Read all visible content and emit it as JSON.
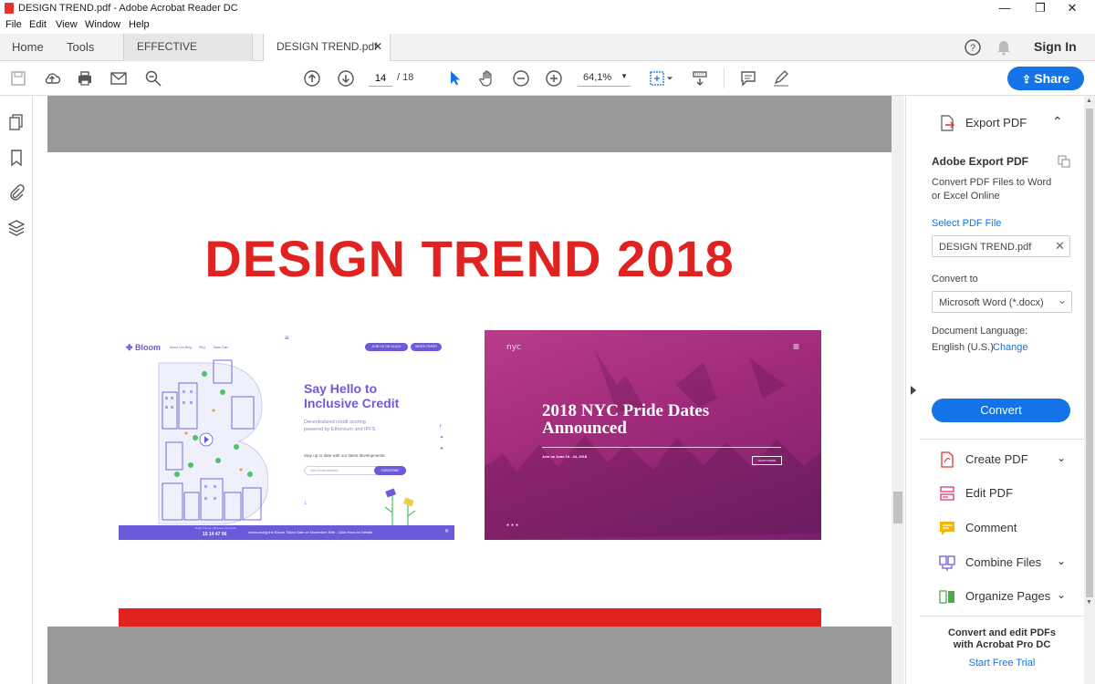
{
  "window": {
    "title": "DESIGN TREND.pdf - Adobe Acrobat Reader DC",
    "minimize_glyph": "—",
    "restore_glyph": "❐",
    "close_glyph": "✕"
  },
  "menu": [
    "File",
    "Edit",
    "View",
    "Window",
    "Help"
  ],
  "tabs": {
    "home": "Home",
    "tools": "Tools",
    "doc1": "EFFECTIVE PRESEN...",
    "doc2": "DESIGN TREND.pdf",
    "doc2_close": "✕",
    "sign_in": "Sign In"
  },
  "toolbar": {
    "page_current": "14",
    "page_total": "/ 18",
    "zoom": "64,1%",
    "share": "Share"
  },
  "document": {
    "heading": "DESIGN TREND 2018",
    "thumb1": {
      "brand": "Bloom",
      "nav": [
        "About Our Blog",
        "FAQ",
        "Token Sale"
      ],
      "btn1": "JOIN US ON SLACK",
      "btn2": "WHITE PAPER",
      "headline1": "Say Hello to",
      "headline2": "Inclusive Credit",
      "sub1": "Decentralized credit scoring",
      "sub2": "powered by Ethereum and IPFS",
      "signup": "Stay up to date with our latest developments",
      "email_placeholder": "Your Email Address",
      "subscribe": "SUBSCRIBE",
      "footer_labels": "Days | Hours | Minutes | Seconds",
      "footer_count": "15  14  47  06",
      "footer_text": "Announcing the Bloom Token Sale on November 30th - Click Here for Details"
    },
    "thumb2": {
      "logo": "nyc",
      "title1": "2018 NYC Pride Dates",
      "title2": "Announced",
      "subtitle": "Join us June 15 - 24, 2018",
      "button": "LEARN MORE"
    }
  },
  "right_panel": {
    "export_header": "Export PDF",
    "title": "Adobe Export PDF",
    "desc1": "Convert PDF Files to Word",
    "desc2": "or Excel Online",
    "select_link": "Select PDF File",
    "file_name": "DESIGN TREND.pdf",
    "convert_to_label": "Convert to",
    "format": "Microsoft Word (*.docx)",
    "lang_label": "Document Language:",
    "lang_value": "English (U.S.)",
    "change_link": "Change",
    "convert_btn": "Convert",
    "tools": [
      {
        "label": "Create PDF",
        "chev": "⌄"
      },
      {
        "label": "Edit PDF",
        "chev": ""
      },
      {
        "label": "Comment",
        "chev": ""
      },
      {
        "label": "Combine Files",
        "chev": "⌄"
      },
      {
        "label": "Organize Pages",
        "chev": "⌄"
      }
    ],
    "promo1": "Convert and edit PDFs",
    "promo2": "with Acrobat Pro DC",
    "trial_link": "Start Free Trial"
  },
  "colors": {
    "accent": "#1473e6",
    "heading_red": "#e02220",
    "purple": "#6b5bdb"
  }
}
